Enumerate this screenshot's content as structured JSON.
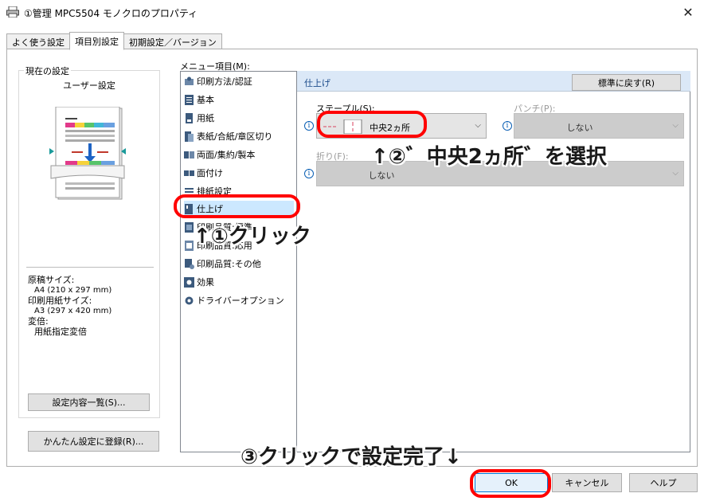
{
  "window": {
    "title": "①管理 MPC5504 モノクロのプロパティ",
    "close_glyph": "✕"
  },
  "tabs": [
    {
      "label": "よく使う設定"
    },
    {
      "label": "項目別設定"
    },
    {
      "label": "初期設定／バージョン"
    }
  ],
  "current": {
    "group_label": "現在の設定",
    "preset_name": "ユーザー設定",
    "original_size_label": "原稿サイズ:",
    "original_size_value": "A4 (210 x 297 mm)",
    "print_size_label": "印刷用紙サイズ:",
    "print_size_value": "A3 (297 x 420 mm)",
    "scale_label": "変倍:",
    "scale_value": "用紙指定変倍",
    "list_button": "設定内容一覧(S)...",
    "register_button": "かんたん設定に登録(R)..."
  },
  "menu": {
    "label": "メニュー項目(M):",
    "items": [
      {
        "label": "印刷方法/認証",
        "icon": "print-method-icon"
      },
      {
        "label": "基本",
        "icon": "basic-icon"
      },
      {
        "label": "用紙",
        "icon": "paper-icon"
      },
      {
        "label": "表紙/合紙/章区切り",
        "icon": "cover-icon"
      },
      {
        "label": "両面/集約/製本",
        "icon": "duplex-icon"
      },
      {
        "label": "面付け",
        "icon": "imposition-icon"
      },
      {
        "label": "排紙設定",
        "icon": "output-icon"
      },
      {
        "label": "仕上げ",
        "icon": "finishing-icon"
      },
      {
        "label": "印刷品質:標準",
        "icon": "quality-standard-icon"
      },
      {
        "label": "印刷品質:応用",
        "icon": "quality-advanced-icon"
      },
      {
        "label": "印刷品質:その他",
        "icon": "quality-other-icon"
      },
      {
        "label": "効果",
        "icon": "effect-icon"
      },
      {
        "label": "ドライバーオプション",
        "icon": "driver-option-icon"
      }
    ],
    "selected_index": 7
  },
  "panel": {
    "title": "仕上げ",
    "reset_button": "標準に戻す(R)",
    "staple_label": "ステープル(S):",
    "staple_value": "中央2ヵ所",
    "punch_label": "パンチ(P):",
    "punch_value": "しない",
    "fold_label": "折り(F):",
    "fold_value": "しない",
    "info_glyph": "i",
    "arrow_glyph": "⌵"
  },
  "footer": {
    "ok": "OK",
    "cancel": "キャンセル",
    "help": "ヘルプ"
  },
  "annotations": {
    "step1": "↑①クリック",
    "step2": "↑②゛中央2ヵ所゛を選択",
    "step3": "③クリックで設定完了↓"
  },
  "colors": {
    "annotation_red": "#ff0000",
    "selected_bg": "#cce8ff",
    "header_bg": "#dbe8f7"
  }
}
